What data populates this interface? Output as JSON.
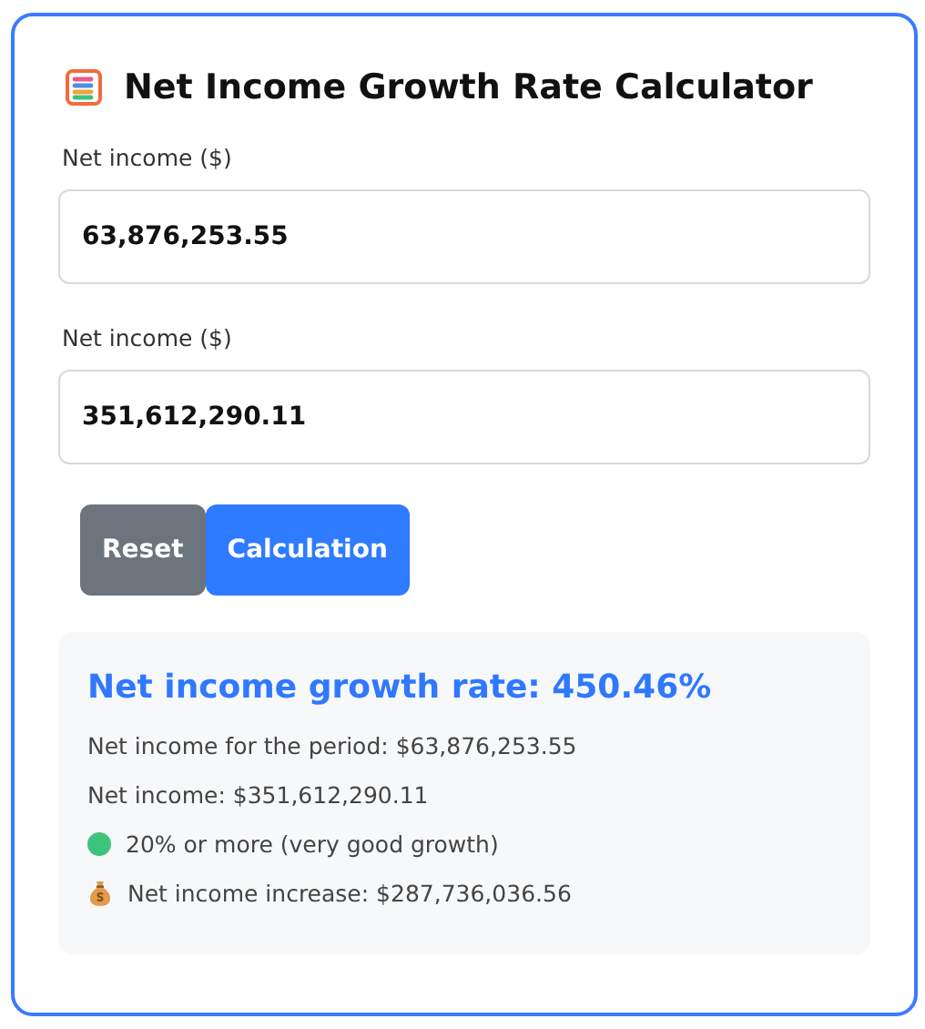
{
  "title": "Net Income Growth Rate Calculator",
  "fields": [
    {
      "label": "Net income ($)",
      "value": "63,876,253.55"
    },
    {
      "label": "Net income ($)",
      "value": "351,612,290.11"
    }
  ],
  "buttons": [
    {
      "label": "Reset",
      "kind": "secondary"
    },
    {
      "label": "Calculation",
      "kind": "primary"
    }
  ],
  "result": {
    "heading": "Net income growth rate: 450.46%",
    "lines": [
      "Net income for the period: $63,876,253.55",
      "Net income: $351,612,290.11"
    ],
    "rating": {
      "text": "20% or more (very good growth)",
      "color": "#3cc47c"
    },
    "increase": "Net income increase: $287,736,036.56"
  }
}
